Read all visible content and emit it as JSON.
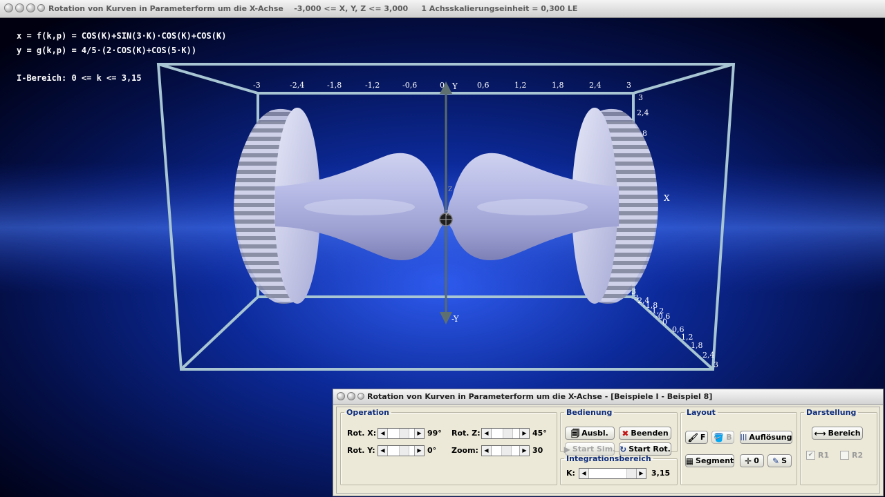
{
  "main_window": {
    "title": "Rotation von Kurven in Parameterform um die X-Achse    -3,000 <= X, Y, Z <= 3,000     1 Achsskalierungseinheit = 0,300 LE"
  },
  "formulas": {
    "x": "x = f(k,p) = COS(K)+SIN(3·K)·COS(K)+COS(K)",
    "y": "y = g(k,p) = 4/5·(2·COS(K)+COS(5·K))",
    "range": "I-Bereich: 0 <= k <= 3,15"
  },
  "axes": {
    "top_ticks": [
      "-3",
      "-2,4",
      "-1,8",
      "-1,2",
      "-0,6",
      "0",
      "0,6",
      "1,2",
      "1,8",
      "2,4",
      "3"
    ],
    "right_ticks": [
      "3",
      "2,4",
      "8"
    ],
    "depth_ticks": [
      "3",
      "-3",
      "2,4",
      "-1,8",
      "-1,2",
      "-0,6",
      "0",
      "0,6",
      "1,2",
      "1,8",
      "2,4",
      "3"
    ],
    "y_label": "Y",
    "neg_y_label": "-Y",
    "x_label": "X",
    "z_label": "Z",
    "z_label_small": "Z"
  },
  "panel": {
    "title": "Rotation von Kurven in Parameterform um die X-Achse - [Beispiele I - Beispiel 8]",
    "operation": {
      "legend": "Operation",
      "rot_x_label": "Rot. X:",
      "rot_x_value": "99°",
      "rot_z_label": "Rot. Z:",
      "rot_z_value": "45°",
      "rot_y_label": "Rot. Y:",
      "rot_y_value": "0°",
      "zoom_label": "Zoom:",
      "zoom_value": "30"
    },
    "bedienung": {
      "legend": "Bedienung",
      "ausbl": "Ausbl.",
      "beenden": "Beenden",
      "start_sim": "Start Sim.",
      "start_rot": "Start Rot."
    },
    "integration": {
      "legend": "Integrationsbereich",
      "k_label": "K:",
      "k_value": "3,15"
    },
    "layout": {
      "legend": "Layout",
      "f": "F",
      "b": "B",
      "aufloesung": "Auflösung",
      "segment": "Segment",
      "zero": "0",
      "s": "S"
    },
    "darstellung": {
      "legend": "Darstellung",
      "bereich": "Bereich",
      "r1": "R1",
      "r2": "R2"
    }
  },
  "colors": {
    "panel_bg": "#ece9d8",
    "legend_text": "#0b2a7a",
    "scene_blue": "#1a3fd0",
    "box_line": "#a8c8d4"
  }
}
